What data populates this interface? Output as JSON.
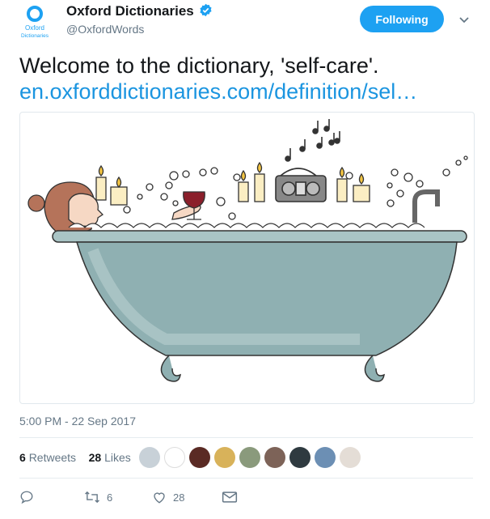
{
  "account": {
    "name": "Oxford Dictionaries",
    "handle": "@OxfordWords",
    "logo_text_1": "Oxford",
    "logo_text_2": "Dictionaries",
    "follow_label": "Following"
  },
  "tweet": {
    "text": "Welcome to the dictionary, 'self-care'.",
    "link": "en.oxforddictionaries.com/definition/sel…",
    "timestamp": "5:00 PM - 22 Sep 2017"
  },
  "stats": {
    "retweets_count": "6",
    "retweets_label": "Retweets",
    "likes_count": "28",
    "likes_label": "Likes"
  },
  "actions": {
    "reply_count": "",
    "retweet_count": "6",
    "like_count": "28"
  },
  "colors": {
    "accent": "#1da1f2",
    "link": "#1b95e0",
    "muted": "#657786",
    "tub": "#8fb0b2"
  },
  "icons": [
    "verified-badge-icon",
    "chevron-down-icon",
    "reply-icon",
    "retweet-icon",
    "like-icon",
    "message-icon"
  ]
}
